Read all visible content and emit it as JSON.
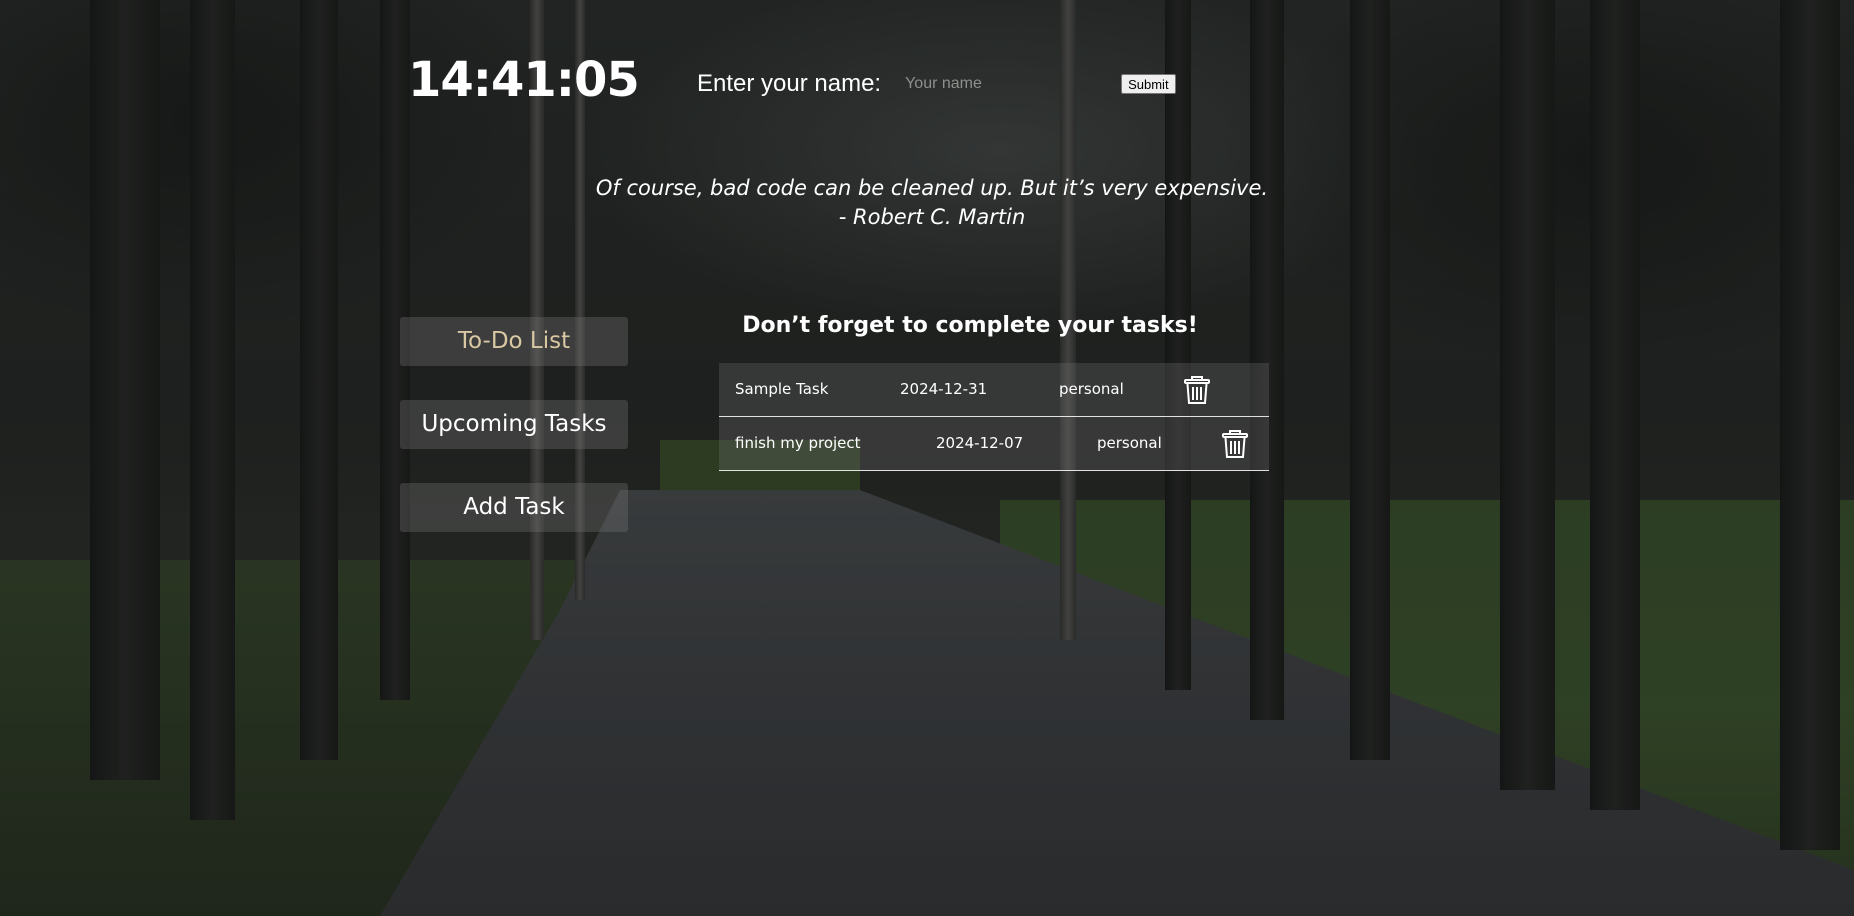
{
  "clock": {
    "time": "14:41:05"
  },
  "greeting": {
    "label": "Enter your name:",
    "input_placeholder": "Your name",
    "input_value": "",
    "submit_label": "Submit"
  },
  "quote": {
    "text": "Of course, bad code can be cleaned up. But it’s very expensive.",
    "author": "- Robert C. Martin"
  },
  "nav": {
    "items": [
      {
        "label": "To-Do List",
        "active": true
      },
      {
        "label": "Upcoming Tasks",
        "active": false
      },
      {
        "label": "Add Task",
        "active": false
      }
    ]
  },
  "tasks": {
    "heading": "Don’t forget to complete your tasks!",
    "items": [
      {
        "name": "Sample Task",
        "date": "2024-12-31",
        "category": "personal",
        "delete_icon": "trash-icon"
      },
      {
        "name": "finish my project",
        "date": "2024-12-07",
        "category": "personal",
        "delete_icon": "trash-icon"
      }
    ]
  },
  "colors": {
    "active_nav_text": "#d9c8a3",
    "text": "#ffffff",
    "panel": "rgba(120,120,120,0.3)"
  }
}
